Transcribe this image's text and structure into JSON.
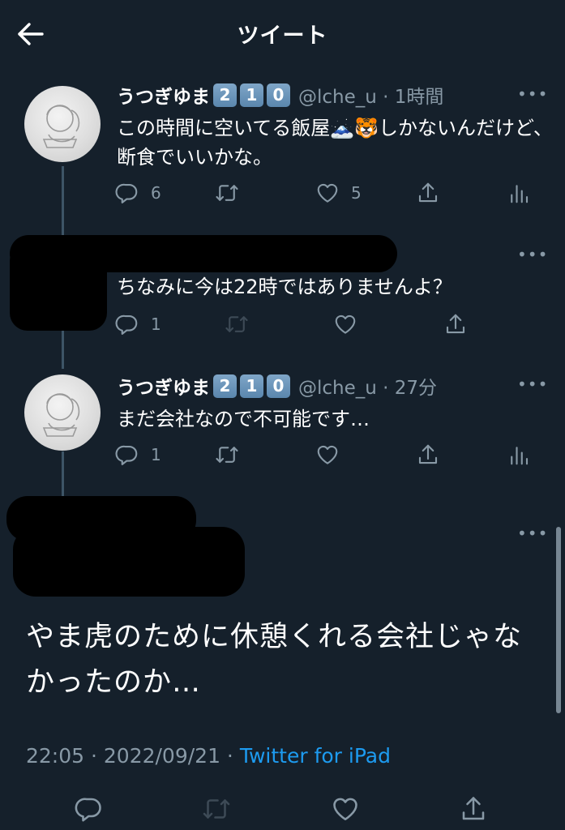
{
  "header": {
    "title": "ツイート"
  },
  "tweet1": {
    "name": "うつぎゆま",
    "badges": [
      "2",
      "1",
      "0"
    ],
    "handle": "@lche_u · 1時間",
    "text": "この時間に空いてる飯屋🗻🐯しかないんだけど、断食でいいかな。",
    "reply_count": "6",
    "like_count": "5"
  },
  "tweet2": {
    "text": "ちなみに今は22時ではありませんよ？",
    "reply_count": "1"
  },
  "tweet3": {
    "name": "うつぎゆま",
    "badges": [
      "2",
      "1",
      "0"
    ],
    "handle": "@lche_u · 27分",
    "text": "まだ会社なので不可能です…",
    "reply_count": "1"
  },
  "main_tweet": {
    "text": "やま虎のために休憩くれる会社じゃなかったのか…",
    "time": "22:05 · 2022/09/21 · ",
    "source": "Twitter for iPad"
  },
  "icons": {
    "back": "arrow-left-icon",
    "reply": "reply-icon",
    "retweet": "retweet-icon",
    "like": "heart-icon",
    "share": "share-icon",
    "analytics": "analytics-icon",
    "more": "more-icon"
  },
  "colors": {
    "background": "#15202b",
    "secondary": "#8899a6",
    "accent": "#1d9bf0"
  }
}
